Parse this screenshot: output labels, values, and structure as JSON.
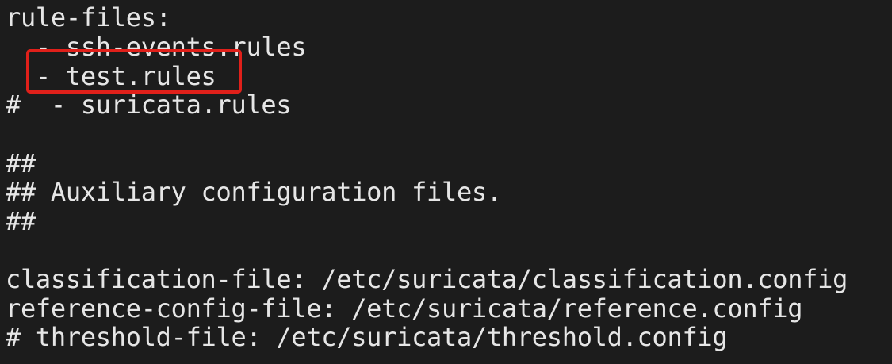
{
  "terminal": {
    "lines": [
      "rule-files:",
      "  - ssh-events.rules",
      "  - test.rules",
      "#  - suricata.rules",
      "",
      "##",
      "## Auxiliary configuration files.",
      "##",
      "",
      "classification-file: /etc/suricata/classification.config",
      "reference-config-file: /etc/suricata/reference.config",
      "# threshold-file: /etc/suricata/threshold.config"
    ]
  },
  "annotation": {
    "highlight_color": "#e0201a",
    "highlighted_line": "  - test.rules"
  }
}
